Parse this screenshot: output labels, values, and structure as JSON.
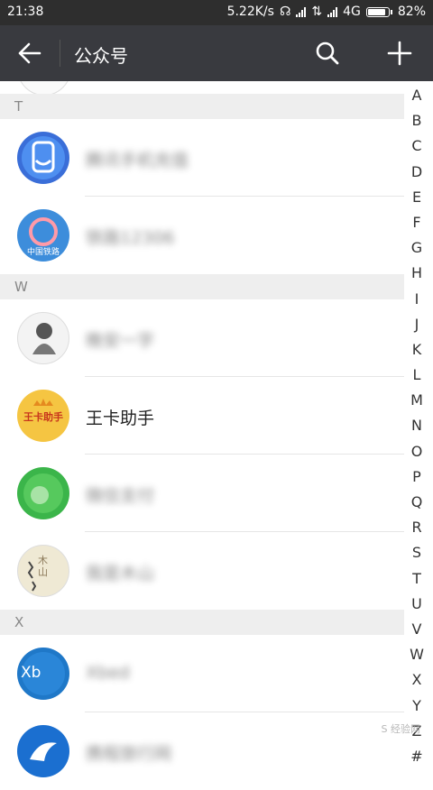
{
  "status_bar": {
    "time": "21:38",
    "speed": "5.22K/s",
    "network": "4G",
    "battery": "82%"
  },
  "header": {
    "title": "公众号"
  },
  "sections": [
    {
      "letter": "T",
      "items": [
        {
          "name": "腾讯手机充值",
          "blurred": true,
          "avatar_color": "#3a6ed8",
          "icon": "phone-shield-icon"
        },
        {
          "name": "铁路12306",
          "blurred": true,
          "avatar_color": "#3d8ddb",
          "avatar_caption": "中国铁路",
          "icon": "railway-icon"
        }
      ]
    },
    {
      "letter": "W",
      "items": [
        {
          "name": "晚安一字",
          "blurred": true,
          "avatar_color": "#f3f3f3",
          "icon": "person-sketch-icon"
        },
        {
          "name": "王卡助手",
          "blurred": false,
          "avatar_color": "#f5c542",
          "avatar_caption": "王卡助手",
          "icon": "crown-icon"
        },
        {
          "name": "微信支付",
          "blurred": true,
          "avatar_color": "#3bb54a",
          "icon": "wechat-pay-icon"
        },
        {
          "name": "我是木山",
          "blurred": true,
          "avatar_color": "#efe9d4",
          "avatar_caption": "木山",
          "icon": "calligraphy-icon"
        }
      ]
    },
    {
      "letter": "X",
      "items": [
        {
          "name": "Xbed",
          "blurred": true,
          "avatar_color": "#1f78c8",
          "avatar_caption": "Xb",
          "icon": "xbed-logo-icon"
        },
        {
          "name": "携程旅行网",
          "blurred": true,
          "avatar_color": "#1b6fd0",
          "icon": "dolphin-icon"
        }
      ]
    }
  ],
  "index_letters": [
    "A",
    "B",
    "C",
    "D",
    "E",
    "F",
    "G",
    "H",
    "I",
    "J",
    "K",
    "L",
    "M",
    "N",
    "O",
    "P",
    "Q",
    "R",
    "S",
    "T",
    "U",
    "V",
    "W",
    "X",
    "Y",
    "Z",
    "#"
  ],
  "watermark": "S 经验网"
}
